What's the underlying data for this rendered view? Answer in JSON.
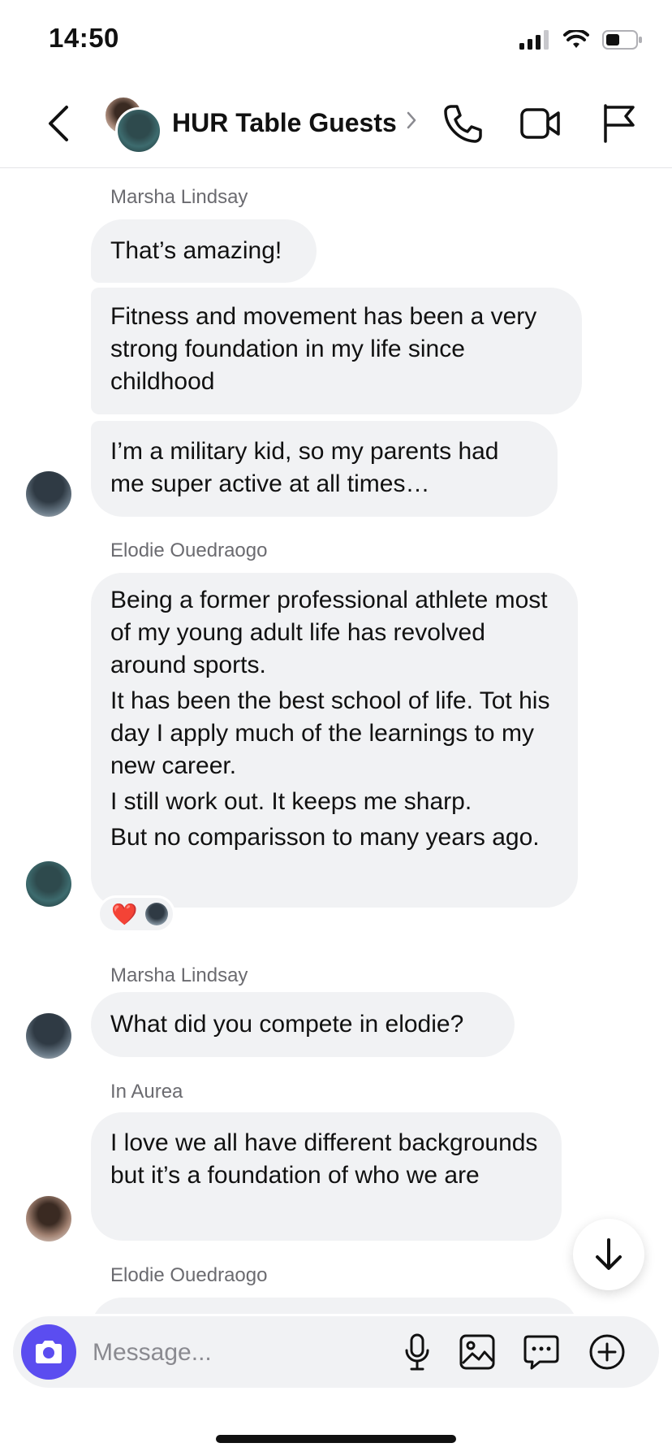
{
  "status_bar": {
    "time": "14:50"
  },
  "header": {
    "title": "HUR Table Guests"
  },
  "messages": [
    {
      "sender": "Marsha Lindsay",
      "bubbles": [
        {
          "text": "That’s amazing!"
        },
        {
          "text": "Fitness and movement has been a very strong foundation in my life since childhood"
        },
        {
          "text": "I’m a military kid, so my parents had me super active at all times…"
        }
      ]
    },
    {
      "sender": "Elodie Ouedraogo",
      "bubbles": [
        {
          "paragraphs": [
            "Being a former professional athlete most of my young adult life has revolved around sports.",
            "It has been the best school of life. Tot his day I apply much of the learnings to my new career.",
            "I still work out. It keeps me sharp.",
            "But no comparisson to many years ago."
          ]
        }
      ],
      "reaction": {
        "emoji": "❤️"
      }
    },
    {
      "sender": "Marsha Lindsay",
      "bubbles": [
        {
          "text": "What did you compete in elodie?"
        }
      ]
    },
    {
      "sender": "In Aurea",
      "bubbles": [
        {
          "text": "I love we all have different backgrounds but it’s a foundation of who we are"
        }
      ]
    },
    {
      "sender": "Elodie Ouedraogo",
      "bubbles": []
    }
  ],
  "composer": {
    "placeholder": "Message..."
  },
  "colors": {
    "accent": "#5b4df0",
    "bubble": "#f1f2f4",
    "reaction_heart": "#e11d2e"
  },
  "icons": [
    "back-icon",
    "chevron-right-icon",
    "phone-icon",
    "video-icon",
    "flag-icon",
    "camera-icon",
    "microphone-icon",
    "image-icon",
    "chat-bubble-icon",
    "plus-circle-icon",
    "arrow-down-icon"
  ]
}
